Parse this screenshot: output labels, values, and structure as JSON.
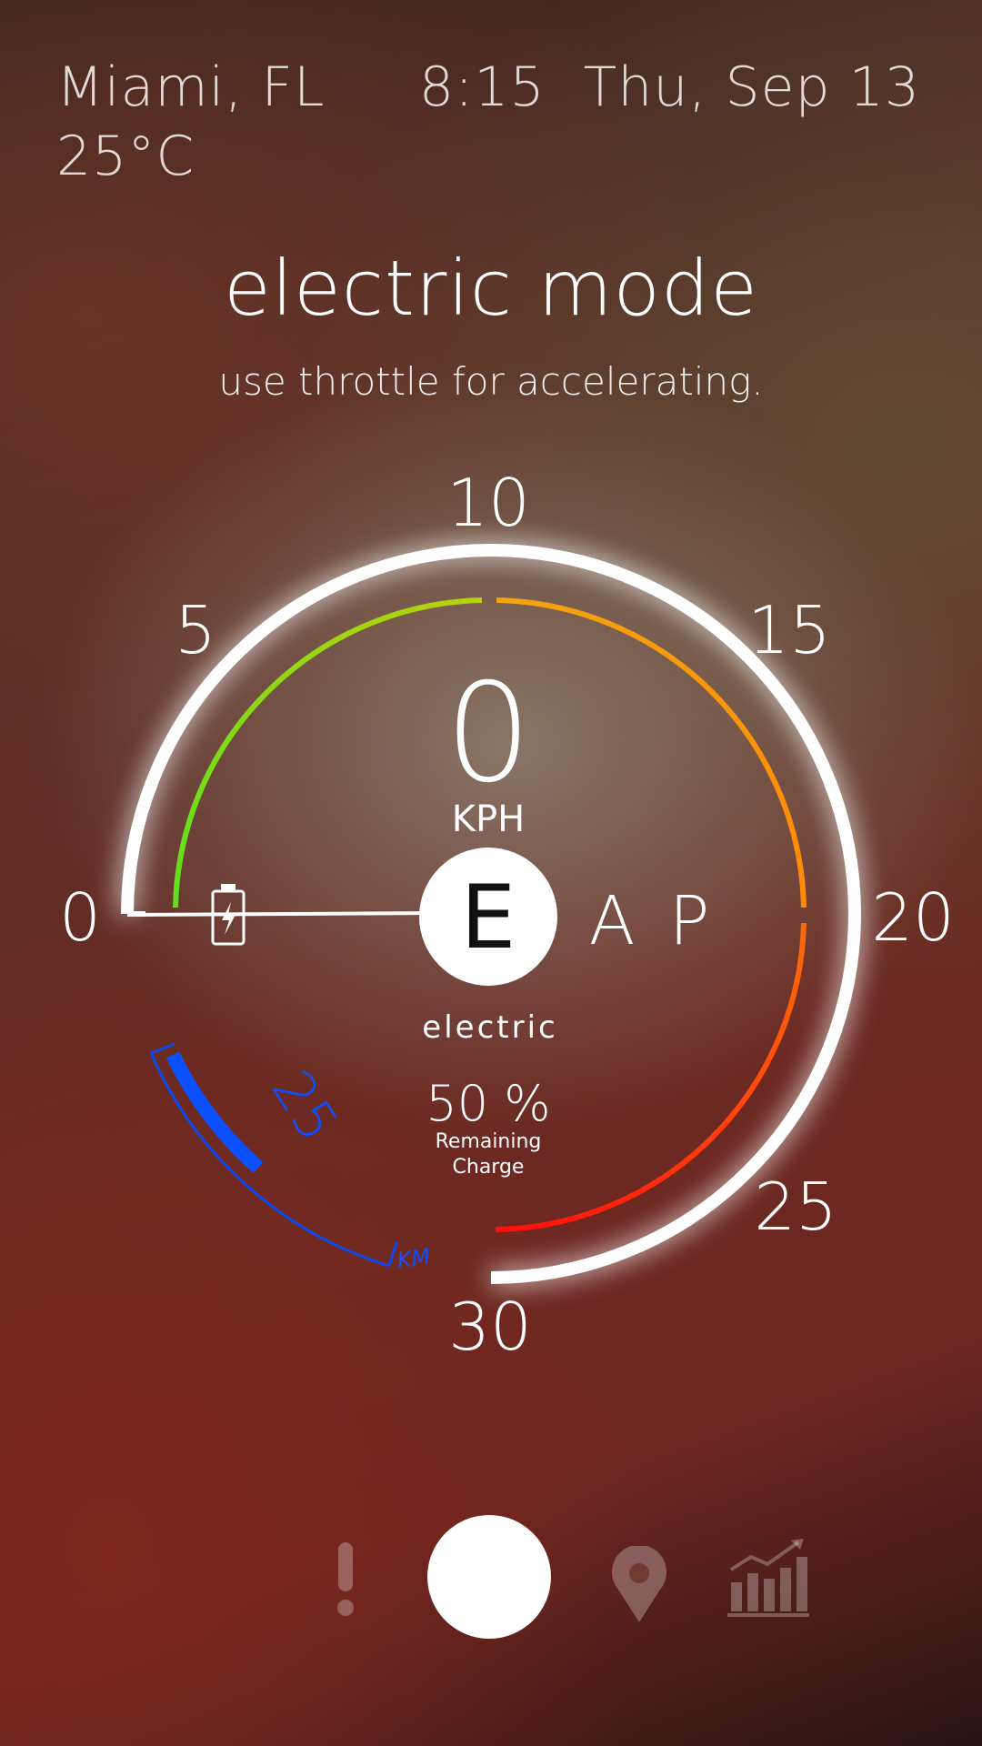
{
  "weather": {
    "location": "Miami, FL",
    "temperature": "25°C"
  },
  "clock": {
    "time": "8:15",
    "date": "Thu, Sep 13"
  },
  "mode": {
    "title": "electric mode",
    "subtitle": "use throttle for accelerating."
  },
  "speedometer": {
    "speed": "0",
    "unit": "KPH",
    "ticks": [
      "0",
      "5",
      "10",
      "15",
      "20",
      "25",
      "30"
    ],
    "max": 30
  },
  "gear": {
    "current": "E",
    "current_label": "electric",
    "others": [
      "A",
      "P"
    ]
  },
  "battery": {
    "percent_label": "50 %",
    "percent": 50,
    "caption_line1": "Remaining",
    "caption_line2": "Charge",
    "icon": "battery-charging-icon"
  },
  "range": {
    "value": "25",
    "unit": "KM",
    "fill_fraction": 0.35
  },
  "nav": {
    "items": [
      {
        "icon": "alert-icon"
      },
      {
        "icon": "home-circle-button"
      },
      {
        "icon": "map-pin-icon"
      },
      {
        "icon": "stats-chart-icon"
      }
    ]
  },
  "colors": {
    "accent_white": "#ffffff",
    "range_blue": "#0a50ff",
    "arc_green": "#64e61e",
    "arc_orange": "#ff9a0a",
    "arc_red": "#ff1a10"
  }
}
